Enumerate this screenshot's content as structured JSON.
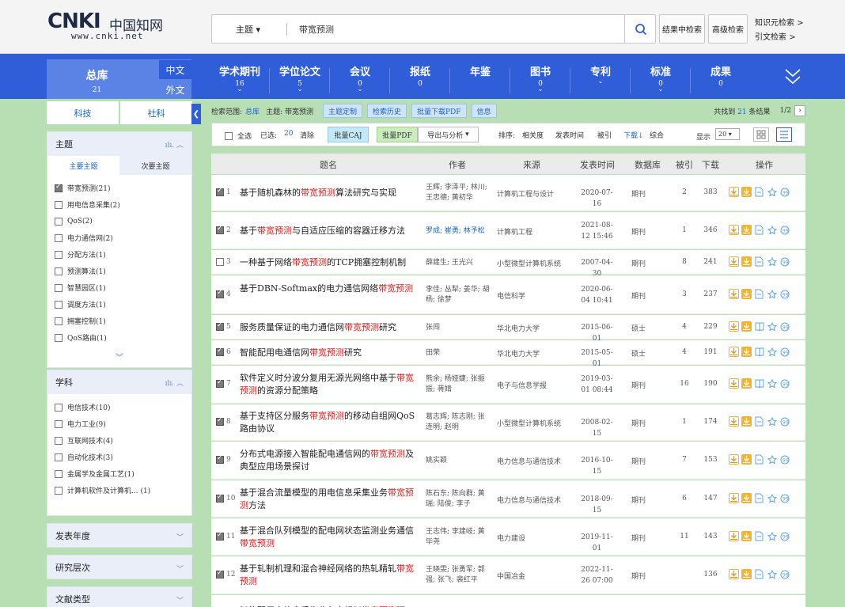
{
  "logo": {
    "mark": "CNKI",
    "cn": "中国知网",
    "url": "www.cnki.net"
  },
  "search": {
    "field": "主题",
    "value": "带宽预测"
  },
  "top_buttons": {
    "result_search": "结果中检索",
    "advanced": "高级检索",
    "knowledge_search": "知识元检索",
    "citation_search": "引文检索"
  },
  "library": {
    "title": "总库",
    "count": "21",
    "zh": "中文",
    "en": "外文"
  },
  "nav_tabs": [
    {
      "label": "学术期刊",
      "count": "16",
      "chevron": true
    },
    {
      "label": "学位论文",
      "count": "5",
      "chevron": true
    },
    {
      "label": "会议",
      "count": "0",
      "chevron": true
    },
    {
      "label": "报纸",
      "count": "0",
      "chevron": false
    },
    {
      "label": "年鉴",
      "count": "",
      "chevron": false
    },
    {
      "label": "图书",
      "count": "0",
      "chevron": true
    },
    {
      "label": "专利",
      "count": "",
      "chevron": true
    },
    {
      "label": "标准",
      "count": "0",
      "chevron": true
    },
    {
      "label": "成果",
      "count": "0",
      "chevron": false
    }
  ],
  "sidebar": {
    "tabs": [
      "科技",
      "社科"
    ],
    "topic": {
      "title": "主题",
      "subtabs": [
        "主要主题",
        "次要主题"
      ],
      "items": [
        {
          "label": "带宽预测(21)",
          "checked": true
        },
        {
          "label": "用电信息采集(2)",
          "checked": false
        },
        {
          "label": "QoS(2)",
          "checked": false
        },
        {
          "label": "电力通信网(2)",
          "checked": false
        },
        {
          "label": "分配方法(1)",
          "checked": false
        },
        {
          "label": "预测算法(1)",
          "checked": false
        },
        {
          "label": "智慧园区(1)",
          "checked": false
        },
        {
          "label": "调度方法(1)",
          "checked": false
        },
        {
          "label": "拥塞控制(1)",
          "checked": false
        },
        {
          "label": "QoS路由(1)",
          "checked": false
        }
      ]
    },
    "subject": {
      "title": "学科",
      "items": [
        {
          "label": "电信技术(10)"
        },
        {
          "label": "电力工业(9)"
        },
        {
          "label": "互联网技术(4)"
        },
        {
          "label": "自动化技术(3)"
        },
        {
          "label": "金属学及金属工艺(1)"
        },
        {
          "label": "计算机软件及计算机... (1)"
        }
      ]
    },
    "collapsed": [
      "发表年度",
      "研究层次",
      "文献类型"
    ]
  },
  "scope": {
    "label": "检索范围:",
    "lib": "总库",
    "query": "主题: 带宽预测",
    "buttons": [
      "主题定制",
      "检索历史",
      "批量下载PDF",
      "信息"
    ],
    "found_prefix": "共找到",
    "found_count": "21",
    "found_suffix": "条结果",
    "page": "1/2"
  },
  "toolbar": {
    "select_all": "全选",
    "selected_label": "已选:",
    "selected_count": "20",
    "clear": "清除",
    "batch_caj": "批量CAJ",
    "batch_pdf": "批量PDF",
    "export": "导出与分析",
    "sort_label": "排序:",
    "sort_options": [
      "相关度",
      "发表时间",
      "被引",
      "下载",
      "综合"
    ],
    "display_label": "显示",
    "page_size": "20"
  },
  "table_headers": [
    "题名",
    "作者",
    "来源",
    "发表时间",
    "数据库",
    "被引",
    "下载",
    "操作"
  ],
  "rows": [
    {
      "n": "1",
      "checked": true,
      "pre": "基于随机森林的",
      "hl": "带宽预测",
      "post": "算法研究与实现",
      "author": "王辉; 李泽平; 林川; 王忠德; 黄初华",
      "source": "计算机工程与设计",
      "date": "2020-07-16",
      "db": "期刊",
      "cite": "2",
      "dl": "383",
      "op3": "doc"
    },
    {
      "n": "2",
      "checked": true,
      "pre": "基于",
      "hl": "带宽预测",
      "post": "与自适应压缩的容器迁移方法",
      "author": "罗成; 崔勇; 林予松",
      "source": "计算机工程",
      "date": "2021-08-12 15:46",
      "db": "期刊",
      "cite": "1",
      "dl": "346",
      "op3": "doc"
    },
    {
      "n": "3",
      "checked": false,
      "pre": "一种基于网络",
      "hl": "带宽预测",
      "post": "的TCP拥塞控制机制",
      "author": "薛建生; 王光兴",
      "source": "小型微型计算机系统",
      "date": "2007-04-30",
      "db": "期刊",
      "cite": "8",
      "dl": "241",
      "op3": "doc"
    },
    {
      "n": "4",
      "checked": true,
      "pre": "基于DBN-Softmax的电力通信网络",
      "hl": "带宽预测",
      "post": "",
      "author": "李佳; 丛犁; 姜华; 胡杨; 徐梦",
      "source": "电信科学",
      "date": "2020-06-04 10:41",
      "db": "期刊",
      "cite": "3",
      "dl": "237",
      "op3": "doc"
    },
    {
      "n": "5",
      "checked": true,
      "pre": "服务质量保证的电力通信网",
      "hl": "带宽预测",
      "post": "研究",
      "author": "张闯",
      "source": "华北电力大学",
      "date": "2015-06-01",
      "db": "硕士",
      "cite": "4",
      "dl": "229",
      "op3": "book"
    },
    {
      "n": "6",
      "checked": true,
      "pre": "智能配用电通信网",
      "hl": "带宽预测",
      "post": "研究",
      "author": "田荣",
      "source": "华北电力大学",
      "date": "2015-05-01",
      "db": "硕士",
      "cite": "4",
      "dl": "191",
      "op3": "book"
    },
    {
      "n": "7",
      "checked": true,
      "pre": "软件定义时分波分复用无源光网络中基于",
      "hl": "带宽预测",
      "post": "的资源分配策略",
      "author": "熊余; 杨娅婕; 张振振; 蒋婧",
      "source": "电子与信息学报",
      "date": "2019-03-01 08:44",
      "db": "期刊",
      "cite": "16",
      "dl": "190",
      "op3": "book"
    },
    {
      "n": "8",
      "checked": true,
      "pre": "基于支持区分服务",
      "hl": "带宽预测",
      "post": "的移动自组网QoS路由协议",
      "author": "葛志辉; 陈志刚; 张连明; 赵明",
      "source": "小型微型计算机系统",
      "date": "2008-02-15",
      "db": "期刊",
      "cite": "1",
      "dl": "174",
      "op3": "doc"
    },
    {
      "n": "9",
      "checked": true,
      "pre": "分布式电源接入智能配电通信网的",
      "hl": "带宽预测",
      "post": "及典型应用场景探讨",
      "author": "姚实颖",
      "source": "电力信息与通信技术",
      "date": "2016-10-15",
      "db": "期刊",
      "cite": "7",
      "dl": "153",
      "op3": "doc"
    },
    {
      "n": "10",
      "checked": true,
      "pre": "基于混合流量模型的用电信息采集业务",
      "hl": "带宽预测",
      "post": "方法",
      "author": "陈石东; 陈向群; 黄瑞; 陆俊; 李子",
      "source": "电力信息与通信技术",
      "date": "2018-09-15",
      "db": "期刊",
      "cite": "6",
      "dl": "147",
      "op3": "doc"
    },
    {
      "n": "11",
      "checked": true,
      "pre": "基于混合队列模型的配电网状态监测业务通信",
      "hl": "带宽预测",
      "post": "",
      "author": "王志伟; 李建岐; 黄毕尧",
      "source": "电力建设",
      "date": "2019-11-01",
      "db": "期刊",
      "cite": "11",
      "dl": "143",
      "op3": "doc"
    },
    {
      "n": "12",
      "checked": true,
      "pre": "基于轧制机理和混合神经网络的热轧精轧",
      "hl": "带宽预测",
      "post": "",
      "author": "王晓雯; 张勇军; 郭强; 张飞; 裴红平",
      "source": "中国冶金",
      "date": "2022-11-26 07:00",
      "db": "期刊",
      "cite": "",
      "dl": "136",
      "op3": "doc"
    },
    {
      "n": "",
      "checked": false,
      "pre": "智能配用电信息采集业务自相似",
      "hl": "带宽预测",
      "post": "研",
      "author": "",
      "source": "",
      "date": "",
      "db": "",
      "cite": "",
      "dl": "",
      "op3": ""
    }
  ]
}
